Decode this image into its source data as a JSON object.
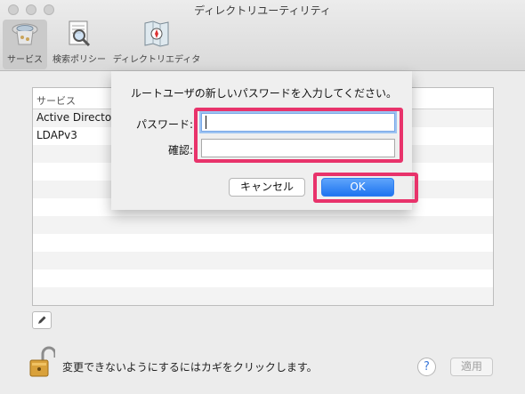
{
  "window": {
    "title": "ディレクトリユーティリティ"
  },
  "toolbar": {
    "items": [
      {
        "label": "サービス",
        "icon": "services-icon",
        "active": true
      },
      {
        "label": "検索ポリシー",
        "icon": "search-policy-icon",
        "active": false
      },
      {
        "label": "ディレクトリエディタ",
        "icon": "directory-editor-icon",
        "active": false
      }
    ]
  },
  "services_table": {
    "header": "サービス",
    "rows": [
      "Active Directory",
      "LDAPv3"
    ]
  },
  "bottom": {
    "lock_text": "変更できないようにするにはカギをクリックします。",
    "help_label": "?",
    "apply_label": "適用"
  },
  "dialog": {
    "message": "ルートユーザの新しいパスワードを入力してください。",
    "password_label": "パスワード:",
    "password_value": "",
    "confirm_label": "確認:",
    "confirm_value": "",
    "cancel_label": "キャンセル",
    "ok_label": "OK"
  },
  "colors": {
    "accent": "#1e74f0",
    "highlight": "#e8336b"
  }
}
